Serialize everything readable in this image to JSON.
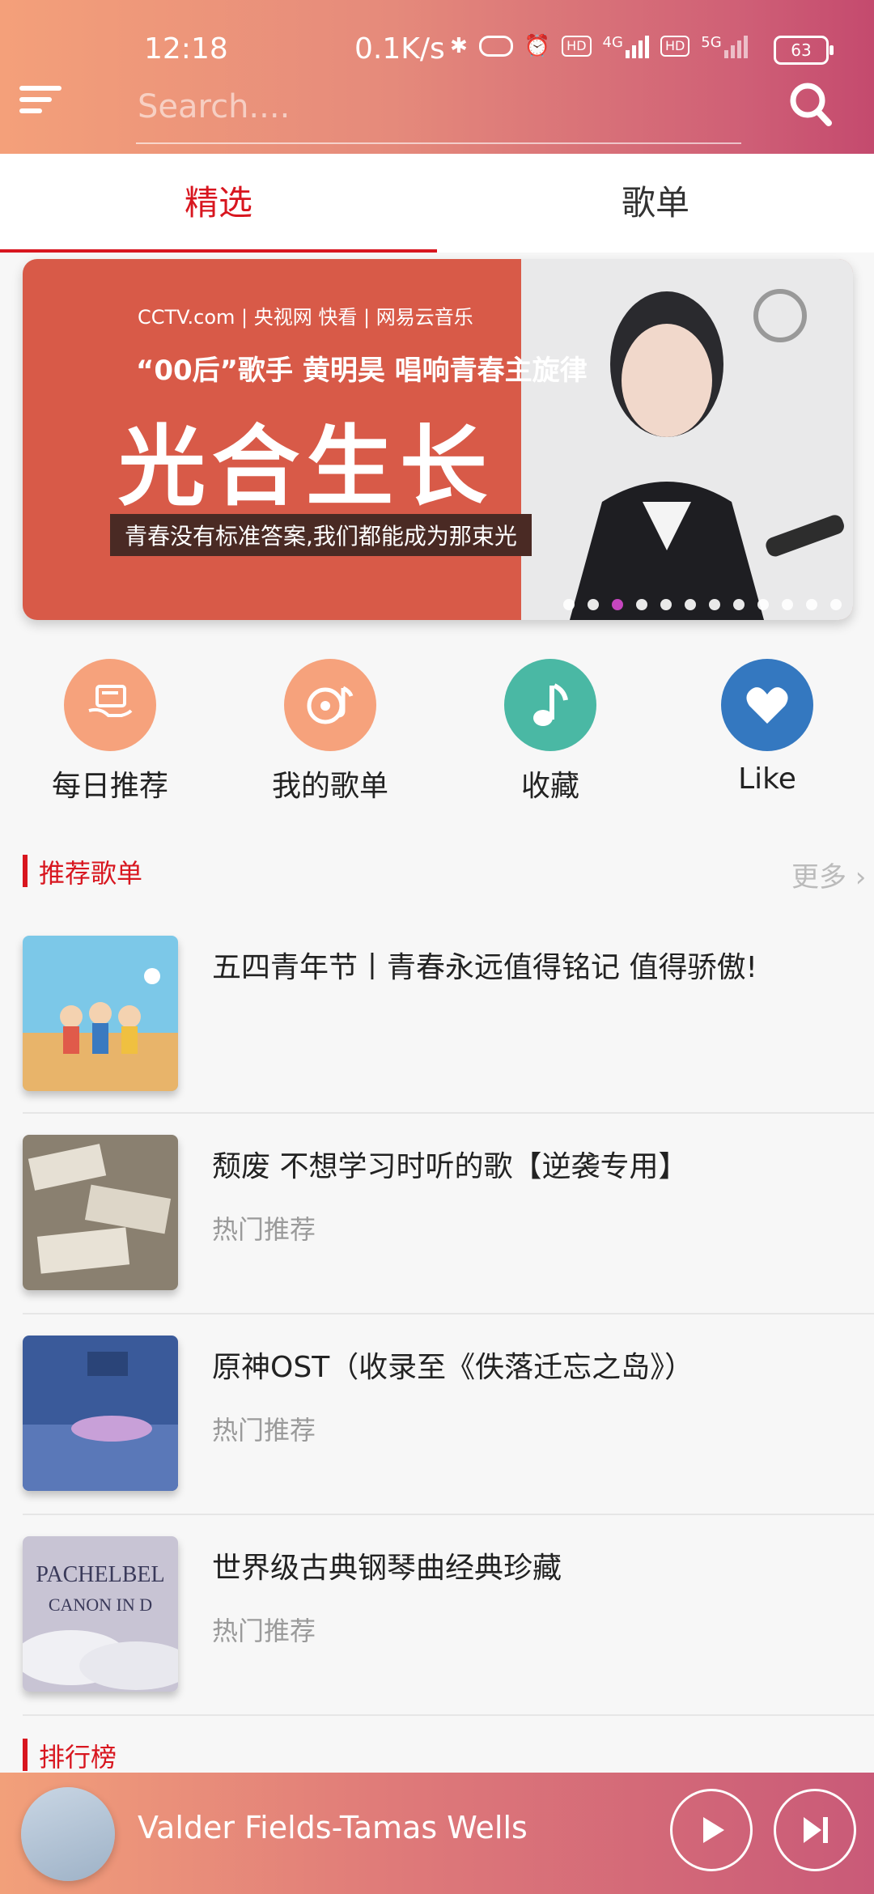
{
  "status": {
    "time": "12:18",
    "net_speed": "0.1K/s",
    "battery": "63",
    "icons": [
      "bluetooth-icon",
      "vibrate-icon",
      "alarm-icon",
      "hd-icon",
      "signal-4g-icon",
      "hd-icon",
      "signal-5g-icon",
      "battery-icon"
    ],
    "signal_labels": [
      "HD",
      "4G",
      "HD",
      "5G"
    ]
  },
  "header": {
    "search_placeholder": "Search...."
  },
  "tabs": [
    {
      "label": "精选",
      "active": true
    },
    {
      "label": "歌单",
      "active": false
    }
  ],
  "banner": {
    "logos": "CCTV.com | 央视网 快看 | 网易云音乐",
    "subtitle": "“00后”歌手 黄明昊 唱响青春主旋律",
    "headline": "光合生长",
    "tagline": "青春没有标准答案,我们都能成为那束光",
    "active_dot": 2,
    "dot_count": 12
  },
  "quick_actions": [
    {
      "label": "每日推荐",
      "icon": "daily-recommend-icon",
      "color": "#f6a27c"
    },
    {
      "label": "我的歌单",
      "icon": "my-playlist-icon",
      "color": "#f6a27c"
    },
    {
      "label": "收藏",
      "icon": "music-note-icon",
      "color": "#4ab8a4"
    },
    {
      "label": "Like",
      "icon": "heart-icon",
      "color": "#3478c0"
    }
  ],
  "sections": {
    "recommended": "推荐歌单",
    "more": "更多",
    "ranking": "排行榜"
  },
  "playlists": [
    {
      "title": "五四青年节丨青春永远值得铭记 值得骄傲!",
      "subtitle": ""
    },
    {
      "title": "颓废 不想学习时听的歌【逆袭专用】",
      "subtitle": "热门推荐"
    },
    {
      "title": "原神OST（收录至《佚落迁忘之岛》）",
      "subtitle": "热门推荐"
    },
    {
      "title": "世界级古典钢琴曲经典珍藏",
      "subtitle": "热门推荐"
    }
  ],
  "thumb_text": {
    "pachelbel": "PACHELBEL",
    "canon": "CANON IN D"
  },
  "player": {
    "track": "Valder Fields-Tamas Wells"
  },
  "colors": {
    "accent": "#d8161f",
    "header_gradient_start": "#f4a07a",
    "header_gradient_end": "#c44a6e"
  }
}
